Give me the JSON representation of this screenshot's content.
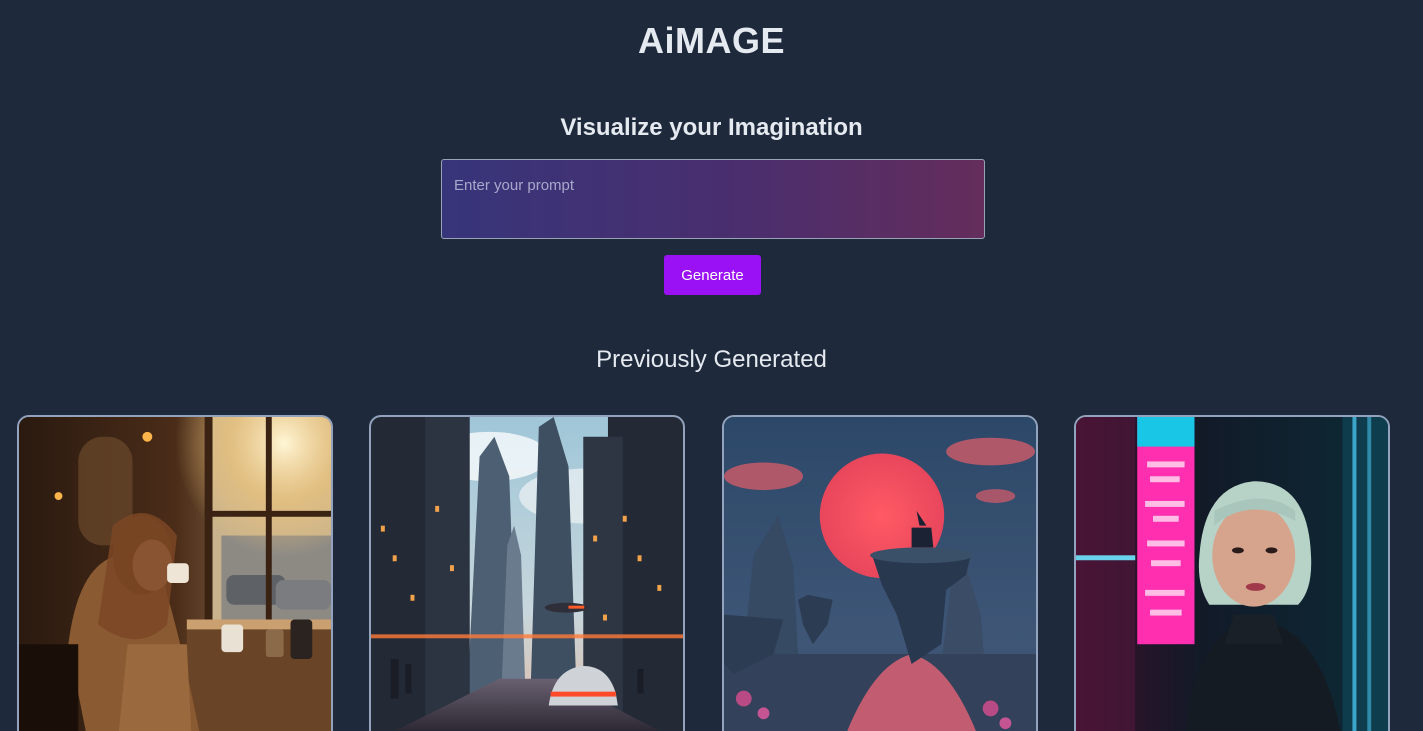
{
  "app": {
    "title": "AiMAGE"
  },
  "hero": {
    "subtitle": "Visualize your Imagination"
  },
  "prompt": {
    "placeholder": "Enter your prompt",
    "value": ""
  },
  "actions": {
    "generate_label": "Generate"
  },
  "gallery": {
    "title": "Previously Generated",
    "items": [
      {
        "name": "girl-coffee-window-image"
      },
      {
        "name": "futuristic-city-street-image"
      },
      {
        "name": "deer-island-sunset-image"
      },
      {
        "name": "neon-portrait-image"
      }
    ]
  },
  "colors": {
    "background": "#1e293b",
    "accent": "#9b11f5",
    "card_border": "#93a3bd",
    "prompt_gradient_start": "#37357a",
    "prompt_gradient_end": "#642d5b"
  }
}
